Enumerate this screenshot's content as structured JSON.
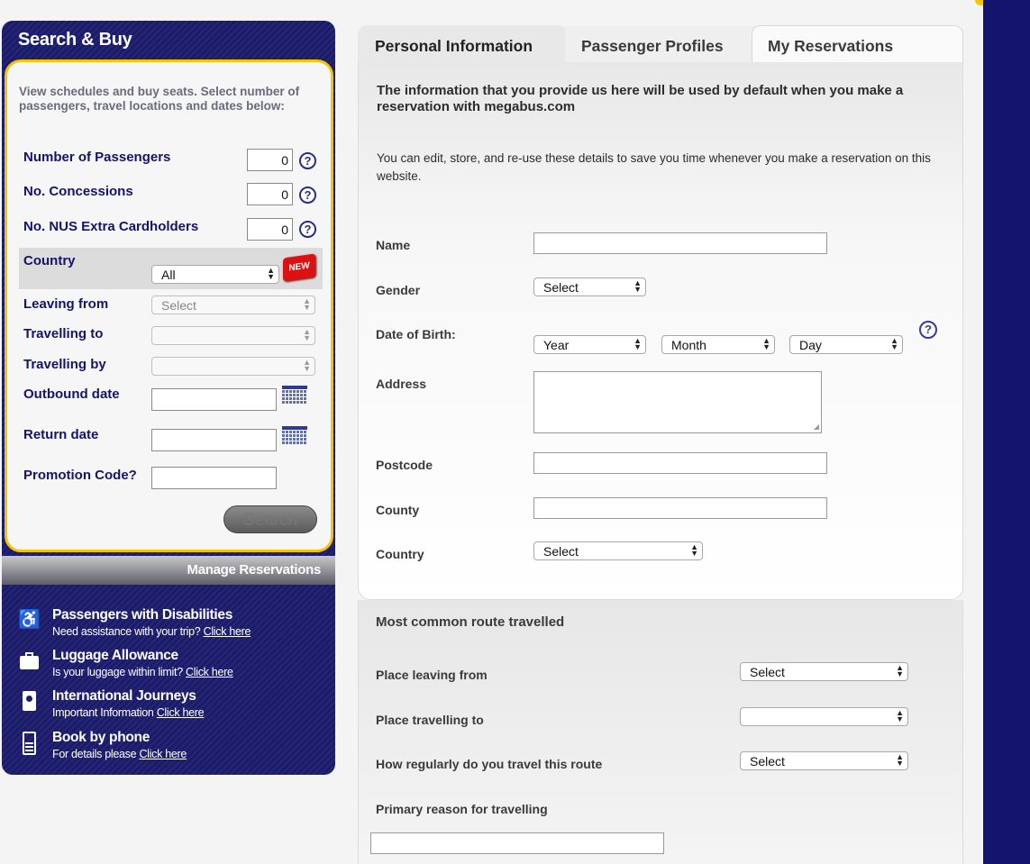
{
  "sidebar": {
    "title": "Search & Buy",
    "intro": "View schedules and buy seats. Select number of passengers, travel locations and dates below:",
    "fields": {
      "num_passengers_label": "Number of Passengers",
      "num_passengers_value": "0",
      "concessions_label": "No. Concessions",
      "concessions_value": "0",
      "nus_label": "No. NUS Extra Cardholders",
      "nus_value": "0",
      "country_label": "Country",
      "country_value": "All",
      "new_badge": "NEW",
      "leaving_label": "Leaving from",
      "leaving_value": "Select",
      "travelling_to_label": "Travelling to",
      "travelling_to_value": "",
      "travelling_by_label": "Travelling by",
      "travelling_by_value": "",
      "outbound_label": "Outbound date",
      "return_label": "Return date",
      "promo_label": "Promotion Code?"
    },
    "help_glyph": "?",
    "search_button": "Search",
    "manage_link": "Manage Reservations",
    "info": [
      {
        "icon": "wheelchair-icon",
        "title": "Passengers with Disabilities",
        "sub": "Need assistance with your trip?",
        "link": "Click here"
      },
      {
        "icon": "luggage-icon",
        "title": "Luggage Allowance",
        "sub": "Is your luggage within limit?",
        "link": "Click here"
      },
      {
        "icon": "passport-icon",
        "title": "International Journeys",
        "sub": "Important Information",
        "link": "Click here"
      },
      {
        "icon": "phone-icon",
        "title": "Book by phone",
        "sub": "For details please",
        "link": "Click here"
      }
    ]
  },
  "tabs": [
    "Personal Information",
    "Passenger Profiles",
    "My Reservations"
  ],
  "main": {
    "intro_bold": "The information that you provide us here will be used by default when you make a reservation with megabus.com",
    "intro_text": "You can edit, store, and re-use these details to save you time whenever you make a reservation on this website.",
    "name_label": "Name",
    "gender_label": "Gender",
    "gender_value": "Select",
    "dob_label": "Date of Birth:",
    "dob_year": "Year",
    "dob_month": "Month",
    "dob_day": "Day",
    "address_label": "Address",
    "postcode_label": "Postcode",
    "county_label": "County",
    "country_label": "Country",
    "country_value": "Select"
  },
  "route": {
    "heading": "Most common route travelled",
    "leaving_label": "Place leaving from",
    "leaving_value": "Select",
    "to_label": "Place travelling to",
    "to_value": "",
    "regular_label": "How regularly do you travel this route",
    "regular_value": "Select",
    "reason_label": "Primary reason for travelling"
  }
}
